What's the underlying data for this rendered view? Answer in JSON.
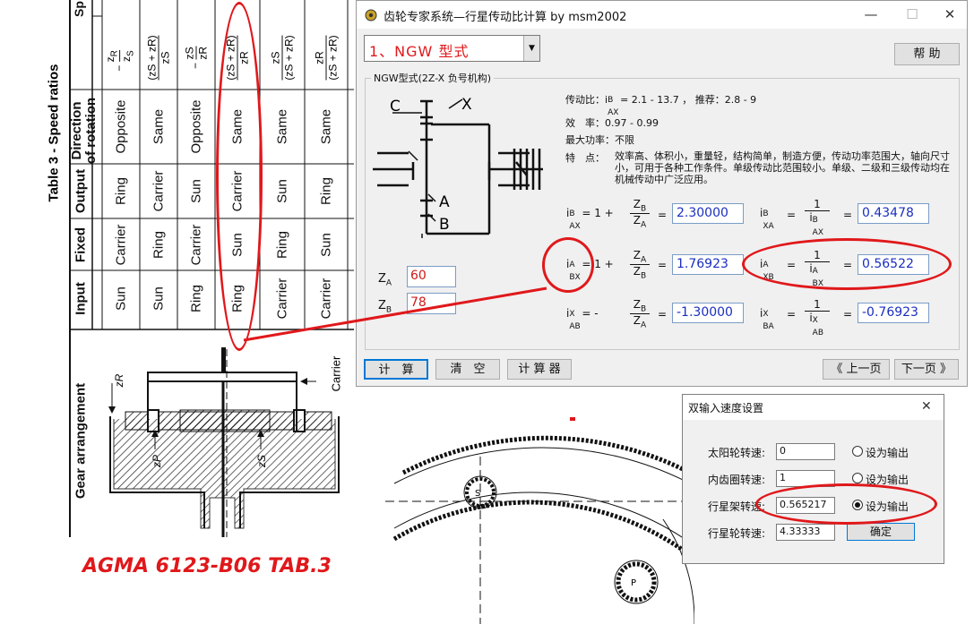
{
  "agma_table": {
    "caption": "Table 3 - Speed ratios",
    "truncated_header": "Sp",
    "headers": {
      "arrangement": "Gear arrangement",
      "input": "Input",
      "fixed": "Fixed",
      "output": "Output",
      "direction": "Direction of rotation",
      "direction_line1": "Direction",
      "direction_line2": "of rotation"
    },
    "rows": [
      {
        "input": "Sun",
        "fixed": "Carrier",
        "output": "Ring",
        "direction": "Opposite",
        "ratio": "− zR / zS",
        "ratio_sign": "−",
        "ratio_num": "z",
        "ratio_num_sub": "R",
        "ratio_den": "z",
        "ratio_den_sub": "S"
      },
      {
        "input": "Sun",
        "fixed": "Ring",
        "output": "Carrier",
        "direction": "Same",
        "ratio": "(zS + zR) / zS",
        "ratio_num": "(zS + zR)",
        "ratio_den": "zS"
      },
      {
        "input": "Ring",
        "fixed": "Carrier",
        "output": "Sun",
        "direction": "Opposite",
        "ratio": "− zS / zR",
        "ratio_sign": "−",
        "ratio_num": "zS",
        "ratio_den": "zR"
      },
      {
        "input": "Ring",
        "fixed": "Sun",
        "output": "Carrier",
        "direction": "Same",
        "ratio": "(zS + zR) / zR",
        "ratio_num": "(zS + zR)",
        "ratio_den": "zR"
      },
      {
        "input": "Carrier",
        "fixed": "Ring",
        "output": "Sun",
        "direction": "Same",
        "ratio": "zS / (zS + zR)",
        "ratio_num": "zS",
        "ratio_den": "(zS + zR)"
      },
      {
        "input": "Carrier",
        "fixed": "Sun",
        "output": "Ring",
        "direction": "Same",
        "ratio": "zR / (zS + zR)",
        "ratio_num": "zR",
        "ratio_den": "(zS + zR)"
      }
    ],
    "drawing_labels": {
      "zR": "zR",
      "carrier": "Carrier",
      "zP": "zP",
      "zS": "zS"
    },
    "reference": "AGMA 6123-B06 TAB.3"
  },
  "calc_window": {
    "title": "齿轮专家系统—行星传动比计算 by msm2002",
    "controls": {
      "minimize": "—",
      "maximize": "☐",
      "close": "✕"
    },
    "type_select": "1、NGW 型式",
    "help_button": "帮 助",
    "group_title": "NGW型式(2Z-X 负号机构)",
    "scheme_labels": {
      "C": "C",
      "X": "X",
      "A": "A",
      "B": "B"
    },
    "info": {
      "ratio_label": "传动比：",
      "ratio_symbol": "i",
      "ratio_sup": "B",
      "ratio_sub": "AX",
      "ratio_range": "= 2.1 - 13.7 ， 推荐：2.8 - 9",
      "efficiency_label": "效　率：",
      "efficiency_value": "0.97 - 0.99",
      "max_power_label": "最大功率：",
      "max_power_value": "不限",
      "features_label": "特　点：",
      "features_text": "效率高、体积小，重量轻，结构简单，制造方便，传动功率范围大，轴向尺寸小，可用于各种工作条件。单级传动比范围较小。单级、二级和三级传动均在机械传动中广泛应用。"
    },
    "equations": {
      "i_BAX": {
        "sup": "B",
        "sub": "AX",
        "expr": "= 1 + ",
        "num": "Z",
        "num_sub": "B",
        "den": "Z",
        "den_sub": "A",
        "eq": "=",
        "value": "2.30000"
      },
      "i_ABX": {
        "sup": "A",
        "sub": "BX",
        "expr": "= 1 + ",
        "num": "Z",
        "num_sub": "A",
        "den": "Z",
        "den_sub": "B",
        "eq": "=",
        "value": "1.76923"
      },
      "i_XAB": {
        "sup": "X",
        "sub": "AB",
        "expr": "= - ",
        "num": "Z",
        "num_sub": "B",
        "den": "Z",
        "den_sub": "A",
        "eq": "=",
        "value": "-1.30000"
      },
      "i_BXA": {
        "sup": "B",
        "sub": "XA",
        "expr": "=",
        "num": "1",
        "den": "i",
        "den_sup": "B",
        "den_sub": "AX",
        "eq": "=",
        "value": "0.43478"
      },
      "i_AXB": {
        "sup": "A",
        "sub": "XB",
        "expr": "=",
        "num": "1",
        "den": "i",
        "den_sup": "A",
        "den_sub": "BX",
        "eq": "=",
        "value": "0.56522"
      },
      "i_XBA": {
        "sup": "X",
        "sub": "BA",
        "expr": "=",
        "num": "1",
        "den": "i",
        "den_sup": "X",
        "den_sub": "AB",
        "eq": "=",
        "value": "-0.76923"
      }
    },
    "inputs": {
      "za_label": "Z",
      "za_sub": "A",
      "za_value": "60",
      "zb_label": "Z",
      "zb_sub": "B",
      "zb_value": "78"
    },
    "buttons": {
      "calc": "计　算",
      "clear": "清　空",
      "calculator": "计 算 器",
      "prev": "《 上一页",
      "next": "下一页 》"
    }
  },
  "speed_dialog": {
    "title": "双输入速度设置",
    "close": "✕",
    "rows": [
      {
        "label": "太阳轮转速:",
        "value": "0",
        "radio_label": "设为输出",
        "selected": false
      },
      {
        "label": "内齿圈转速:",
        "value": "1",
        "radio_label": "设为输出",
        "selected": false
      },
      {
        "label": "行星架转速:",
        "value": "0.565217",
        "radio_label": "设为输出",
        "selected": true
      },
      {
        "label": "行星轮转速:",
        "value": "4.33333"
      }
    ],
    "ok_button": "确定"
  },
  "gear_drawing": {
    "label_s": "S",
    "label_p": "P"
  },
  "colors": {
    "annotation_red": "#e0181b",
    "value_blue": "#1a2ec0",
    "input_red": "#d01818"
  }
}
